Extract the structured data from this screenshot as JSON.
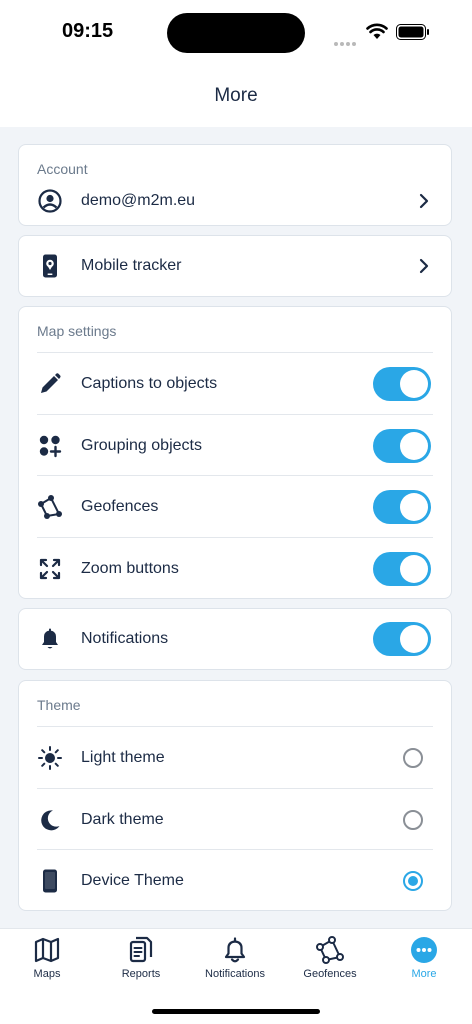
{
  "status": {
    "time": "09:15"
  },
  "header": {
    "title": "More"
  },
  "account": {
    "section_label": "Account",
    "email": "demo@m2m.eu"
  },
  "tracker": {
    "label": "Mobile tracker"
  },
  "map_settings": {
    "section_label": "Map settings",
    "items": [
      {
        "label": "Captions to objects",
        "icon": "pencil-icon",
        "enabled": true
      },
      {
        "label": "Grouping objects",
        "icon": "grouping-icon",
        "enabled": true
      },
      {
        "label": "Geofences",
        "icon": "geofence-icon",
        "enabled": true
      },
      {
        "label": "Zoom buttons",
        "icon": "zoom-icon",
        "enabled": true
      }
    ]
  },
  "notifications": {
    "label": "Notifications",
    "enabled": true
  },
  "theme": {
    "section_label": "Theme",
    "items": [
      {
        "label": "Light theme",
        "icon": "sun-icon",
        "selected": false
      },
      {
        "label": "Dark theme",
        "icon": "moon-icon",
        "selected": false
      },
      {
        "label": "Device Theme",
        "icon": "phone-icon",
        "selected": true
      }
    ]
  },
  "tabbar": {
    "items": [
      {
        "label": "Maps",
        "icon": "map-icon",
        "active": false
      },
      {
        "label": "Reports",
        "icon": "reports-icon",
        "active": false
      },
      {
        "label": "Notifications",
        "icon": "bell-icon",
        "active": false
      },
      {
        "label": "Geofences",
        "icon": "geofence-icon",
        "active": false
      },
      {
        "label": "More",
        "icon": "more-icon",
        "active": true
      }
    ]
  },
  "colors": {
    "accent": "#2aa7e6",
    "text": "#1c2b45",
    "background": "#f1f4f8"
  }
}
